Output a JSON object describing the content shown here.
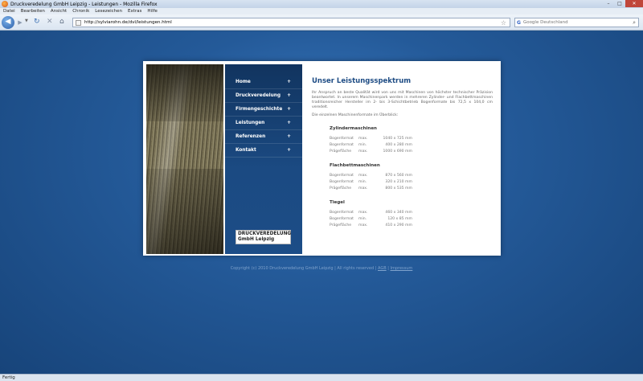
{
  "browser": {
    "title": "Druckveredelung GmbH Leipzig - Leistungen - Mozilla Firefox",
    "menu": [
      "Datei",
      "Bearbeiten",
      "Ansicht",
      "Chronik",
      "Lesezeichen",
      "Extras",
      "Hilfe"
    ],
    "url": "http://sylviarohn.de/dvl/leistungen.html",
    "search_placeholder": "Google Deutschland",
    "status": "Fertig"
  },
  "nav": {
    "items": [
      {
        "label": "Home",
        "icon": "+"
      },
      {
        "label": "Druckveredelung",
        "icon": "+"
      },
      {
        "label": "Firmengeschichte",
        "icon": "+"
      },
      {
        "label": "Leistungen",
        "icon": "+"
      },
      {
        "label": "Referenzen",
        "icon": "+"
      },
      {
        "label": "Kontakt",
        "icon": "+"
      }
    ],
    "logo_line1": "DRUCKVEREDELUNG",
    "logo_line2": "GmbH Leipzig"
  },
  "content": {
    "title": "Unser Leistungsspektrum",
    "intro": "Ihr Anspruch an beste Qualität wird von uns mit Maschinen von höchster technischer Präzision beantwortet. In unserem Maschinenpark werden in mehreren Zylinder- und Flachbettmaschinen traditionsreicher Hersteller im 2- bis 3-Schichtbetrieb Bogenformate bis 72,5 x 104,0 cm veredelt.",
    "intro2": "Die einzelnen Maschinenformate im Überblick:",
    "sections": [
      {
        "heading": "Zylindermaschinen",
        "rows": [
          {
            "a": "Bogenformat",
            "b": "max.",
            "c": "1040 x 725 mm"
          },
          {
            "a": "Bogenformat",
            "b": "min.",
            "c": "400 x 280 mm"
          },
          {
            "a": "Prägefläche",
            "b": "max.",
            "c": "1000 x 690 mm"
          }
        ]
      },
      {
        "heading": "Flachbettmaschinen",
        "rows": [
          {
            "a": "Bogenformat",
            "b": "max.",
            "c": "870 x 560 mm"
          },
          {
            "a": "Bogenformat",
            "b": "min.",
            "c": "320 x 210 mm"
          },
          {
            "a": "Prägefläche",
            "b": "max.",
            "c": "800 x 535 mm"
          }
        ]
      },
      {
        "heading": "Tiegel",
        "rows": [
          {
            "a": "Bogenformat",
            "b": "max.",
            "c": "460 x 340 mm"
          },
          {
            "a": "Bogenformat",
            "b": "min.",
            "c": "120 x 85 mm"
          },
          {
            "a": "Prägefläche",
            "b": "max.",
            "c": "410 x 290 mm"
          }
        ]
      }
    ]
  },
  "footer": {
    "copyright": "Copyright (c) 2010 Druckveredelung GmbH Leipzig | All rights reserved |",
    "agb": "AGB",
    "impressum": "Impressum"
  }
}
